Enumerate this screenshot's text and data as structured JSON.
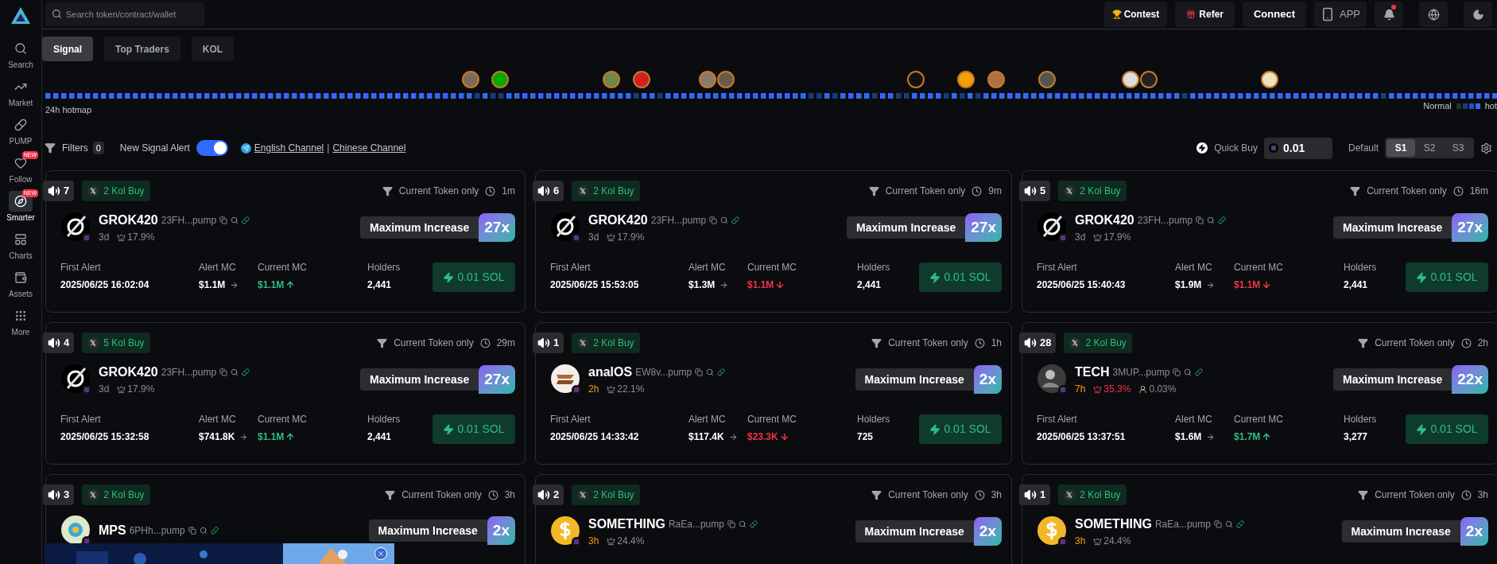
{
  "sidebar": {
    "items": [
      {
        "label": "Search",
        "selected": false
      },
      {
        "label": "Market",
        "selected": false
      },
      {
        "label": "PUMP",
        "selected": false
      },
      {
        "label": "Follow",
        "selected": false,
        "badge": "NEW"
      },
      {
        "label": "Smarter",
        "selected": true,
        "badge": "NEW"
      },
      {
        "label": "Charts",
        "selected": false
      },
      {
        "label": "Assets",
        "selected": false
      },
      {
        "label": "More",
        "selected": false
      }
    ]
  },
  "topbar": {
    "search": {
      "placeholder": "Search token/contract/wallet"
    },
    "contest": "Contest",
    "refer": "Refer",
    "connect": "Connect",
    "app": "APP",
    "notification_dot": true
  },
  "tabs": [
    {
      "label": "Signal",
      "selected": true
    },
    {
      "label": "Top Traders",
      "selected": false
    },
    {
      "label": "KOL",
      "selected": false
    }
  ],
  "hotmap": {
    "label": "24h hotmap",
    "legend_low": "Normal",
    "legend_high": "hot"
  },
  "filters": {
    "label": "Filters",
    "count": "0",
    "alert_label": "New Signal Alert",
    "alert_on": true,
    "english_channel": "English Channel",
    "separator": "|",
    "chinese_channel": "Chinese Channel"
  },
  "quick_buy": {
    "label": "Quick Buy",
    "amount": "0.01",
    "default_label": "Default",
    "presets": [
      {
        "label": "S1",
        "selected": true
      },
      {
        "label": "S2",
        "selected": false
      },
      {
        "label": "S3",
        "selected": false
      }
    ]
  },
  "cards": [
    {
      "count": "7",
      "kol": "2 Kol Buy",
      "filter": "Current Token only",
      "elapsed": "1m",
      "name": "GROK420",
      "address": "23FH...pump",
      "age": "3d",
      "age_recent": false,
      "top10": "17.9%",
      "top10_alert": false,
      "increase_label": "Maximum Increase",
      "multiplier": "27x",
      "stats": {
        "first_alert_label": "First Alert",
        "first_alert": "2025/06/25 16:02:04",
        "alert_mc_label": "Alert MC",
        "alert_mc": "$1.1M",
        "current_mc_label": "Current MC",
        "current_mc": "$1.1M",
        "rising": true,
        "holders_label": "Holders",
        "holders": "2,441",
        "buy": "0.01 SOL"
      }
    },
    {
      "count": "6",
      "kol": "2 Kol Buy",
      "filter": "Current Token only",
      "elapsed": "9m",
      "name": "GROK420",
      "address": "23FH...pump",
      "age": "3d",
      "age_recent": false,
      "top10": "17.9%",
      "top10_alert": false,
      "increase_label": "Maximum Increase",
      "multiplier": "27x",
      "stats": {
        "first_alert_label": "First Alert",
        "first_alert": "2025/06/25 15:53:05",
        "alert_mc_label": "Alert MC",
        "alert_mc": "$1.3M",
        "current_mc_label": "Current MC",
        "current_mc": "$1.1M",
        "rising": false,
        "holders_label": "Holders",
        "holders": "2,441",
        "buy": "0.01 SOL"
      }
    },
    {
      "count": "5",
      "kol": "2 Kol Buy",
      "filter": "Current Token only",
      "elapsed": "16m",
      "name": "GROK420",
      "address": "23FH...pump",
      "age": "3d",
      "age_recent": false,
      "top10": "17.9%",
      "top10_alert": false,
      "increase_label": "Maximum Increase",
      "multiplier": "27x",
      "stats": {
        "first_alert_label": "First Alert",
        "first_alert": "2025/06/25 15:40:43",
        "alert_mc_label": "Alert MC",
        "alert_mc": "$1.9M",
        "current_mc_label": "Current MC",
        "current_mc": "$1.1M",
        "rising": false,
        "holders_label": "Holders",
        "holders": "2,441",
        "buy": "0.01 SOL"
      }
    },
    {
      "count": "4",
      "kol": "5 Kol Buy",
      "filter": "Current Token only",
      "elapsed": "29m",
      "name": "GROK420",
      "address": "23FH...pump",
      "age": "3d",
      "age_recent": false,
      "top10": "17.9%",
      "top10_alert": false,
      "increase_label": "Maximum Increase",
      "multiplier": "27x",
      "stats": {
        "first_alert_label": "First Alert",
        "first_alert": "2025/06/25 15:32:58",
        "alert_mc_label": "Alert MC",
        "alert_mc": "$741.8K",
        "current_mc_label": "Current MC",
        "current_mc": "$1.1M",
        "rising": true,
        "holders_label": "Holders",
        "holders": "2,441",
        "buy": "0.01 SOL"
      }
    },
    {
      "count": "1",
      "kol": "2 Kol Buy",
      "filter": "Current Token only",
      "elapsed": "1h",
      "name": "analOS",
      "address": "EW8v...pump",
      "age": "2h",
      "age_recent": true,
      "top10": "22.1%",
      "top10_alert": false,
      "increase_label": "Maximum Increase",
      "multiplier": "2x",
      "stats": {
        "first_alert_label": "First Alert",
        "first_alert": "2025/06/25 14:33:42",
        "alert_mc_label": "Alert MC",
        "alert_mc": "$117.4K",
        "current_mc_label": "Current MC",
        "current_mc": "$23.3K",
        "rising": false,
        "holders_label": "Holders",
        "holders": "725",
        "buy": "0.01 SOL"
      }
    },
    {
      "count": "28",
      "kol": "2 Kol Buy",
      "filter": "Current Token only",
      "elapsed": "2h",
      "name": "TECH",
      "address": "3MUP...pump",
      "age": "7h",
      "age_recent": true,
      "top10": "35.3%",
      "top10_alert": true,
      "dev": "0.03%",
      "increase_label": "Maximum Increase",
      "multiplier": "22x",
      "stats": {
        "first_alert_label": "First Alert",
        "first_alert": "2025/06/25 13:37:51",
        "alert_mc_label": "Alert MC",
        "alert_mc": "$1.6M",
        "current_mc_label": "Current MC",
        "current_mc": "$1.7M",
        "rising": true,
        "holders_label": "Holders",
        "holders": "3,277",
        "buy": "0.01 SOL"
      }
    },
    {
      "count": "3",
      "kol": "2 Kol Buy",
      "filter": "Current Token only",
      "elapsed": "3h",
      "name": "MPS",
      "address": "6PHh...pump",
      "increase_label": "Maximum Increase",
      "multiplier": "2x"
    },
    {
      "count": "2",
      "kol": "2 Kol Buy",
      "filter": "Current Token only",
      "elapsed": "3h",
      "name": "SOMETHING",
      "address": "RaEa...pump",
      "age": "3h",
      "age_recent": true,
      "top10": "24.4%",
      "top10_alert": false,
      "increase_label": "Maximum Increase",
      "multiplier": "2x"
    },
    {
      "count": "1",
      "kol": "2 Kol Buy",
      "filter": "Current Token only",
      "elapsed": "3h",
      "name": "SOMETHING",
      "address": "RaEa...pump",
      "age": "3h",
      "age_recent": true,
      "top10": "24.4%",
      "top10_alert": false,
      "increase_label": "Maximum Increase",
      "multiplier": "2x"
    }
  ]
}
